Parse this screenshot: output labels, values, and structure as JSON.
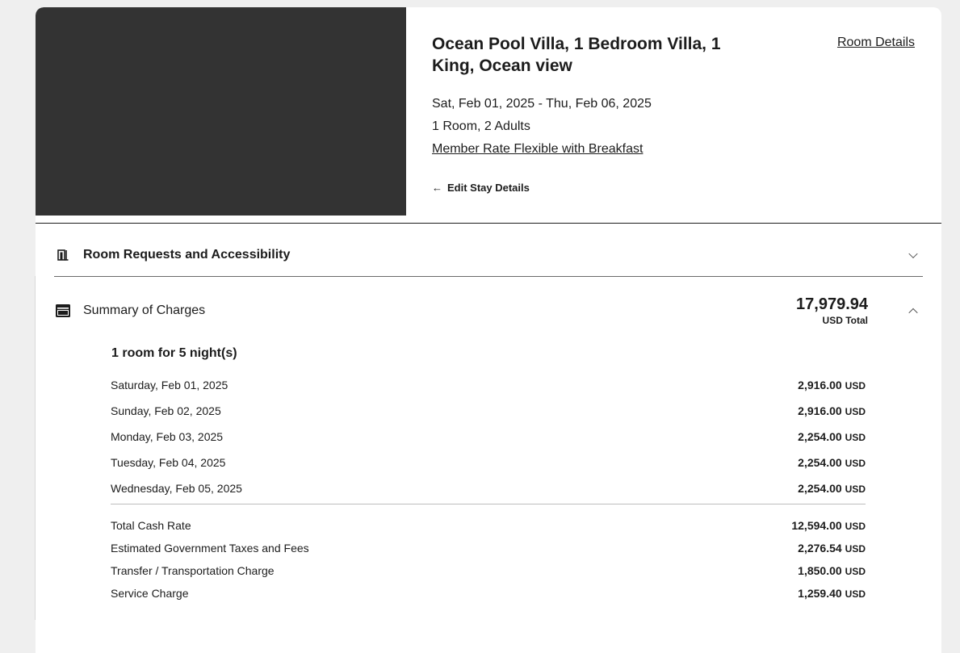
{
  "room": {
    "title": "Ocean Pool Villa, 1 Bedroom Villa, 1 King, Ocean view",
    "details_link": "Room Details",
    "dates": "Sat, Feb 01, 2025 - Thu, Feb 06, 2025",
    "guests": "1 Room, 2 Adults",
    "rate_name": "Member Rate Flexible with Breakfast",
    "edit_label": "Edit Stay Details"
  },
  "requests": {
    "label": "Room Requests and Accessibility",
    "icon": "door-icon"
  },
  "summary": {
    "label": "Summary of Charges",
    "icon": "wallet-icon",
    "total_amount": "17,979.94",
    "total_label": "USD Total",
    "nights_heading": "1 room for 5 night(s)",
    "currency": "USD",
    "nights": [
      {
        "date": "Saturday, Feb 01, 2025",
        "amount": "2,916.00"
      },
      {
        "date": "Sunday, Feb 02, 2025",
        "amount": "2,916.00"
      },
      {
        "date": "Monday, Feb 03, 2025",
        "amount": "2,254.00"
      },
      {
        "date": "Tuesday, Feb 04, 2025",
        "amount": "2,254.00"
      },
      {
        "date": "Wednesday, Feb 05, 2025",
        "amount": "2,254.00"
      }
    ],
    "totals": [
      {
        "label": "Total Cash Rate",
        "amount": "12,594.00"
      },
      {
        "label": "Estimated Government Taxes and Fees",
        "amount": "2,276.54"
      },
      {
        "label": "Transfer / Transportation Charge",
        "amount": "1,850.00"
      },
      {
        "label": "Service Charge",
        "amount": "1,259.40"
      }
    ]
  },
  "colors": {
    "hero_placeholder": "#333333",
    "page_background": "#efefef",
    "text": "#1c1c1c"
  }
}
